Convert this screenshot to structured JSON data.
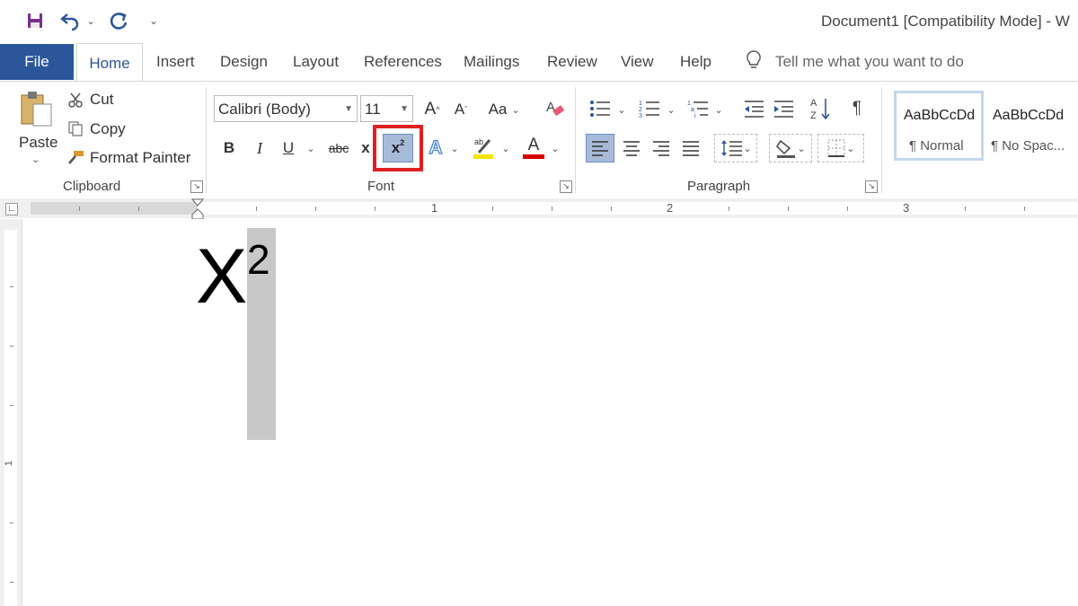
{
  "titlebar": {
    "title": "Document1 [Compatibility Mode]  -  W",
    "quick_access": [
      "save-icon",
      "undo-icon",
      "redo-icon",
      "customize-icon"
    ]
  },
  "tabs": [
    {
      "label": "File"
    },
    {
      "label": "Home",
      "active": true
    },
    {
      "label": "Insert"
    },
    {
      "label": "Design"
    },
    {
      "label": "Layout"
    },
    {
      "label": "References"
    },
    {
      "label": "Mailings"
    },
    {
      "label": "Review"
    },
    {
      "label": "View"
    },
    {
      "label": "Help"
    }
  ],
  "tell_me": {
    "placeholder": "Tell me what you want to do"
  },
  "clipboard": {
    "paste": "Paste",
    "cut": "Cut",
    "copy": "Copy",
    "format_painter": "Format Painter",
    "label": "Clipboard"
  },
  "font": {
    "font_name": "Calibri (Body)",
    "font_size": "11",
    "change_case": "Aa",
    "bold": "B",
    "italic": "I",
    "underline": "U",
    "strikethrough": "abc",
    "subscript": "x",
    "superscript_base": "x",
    "superscript_exp": "2",
    "text_effects": "A",
    "font_color": "A",
    "label": "Font"
  },
  "paragraph": {
    "label": "Paragraph",
    "sort": "A Z",
    "pilcrow": "¶"
  },
  "styles": [
    {
      "preview": "AaBbCcDd",
      "name": "¶ Normal",
      "selected": true
    },
    {
      "preview": "AaBbCcDd",
      "name": "¶ No Spac..."
    }
  ],
  "ruler": {
    "numbers": [
      "1",
      "2",
      "3"
    ],
    "vertical_numbers": [
      "1"
    ]
  },
  "document": {
    "base": "X",
    "superscript": "2"
  },
  "colors": {
    "accent": "#2b579a",
    "highlight_box": "#e02020",
    "highlight_yellow": "#f5e400",
    "font_red": "#d40000",
    "selection": "#c8c8c8",
    "active_button": "#a7bbd9"
  }
}
